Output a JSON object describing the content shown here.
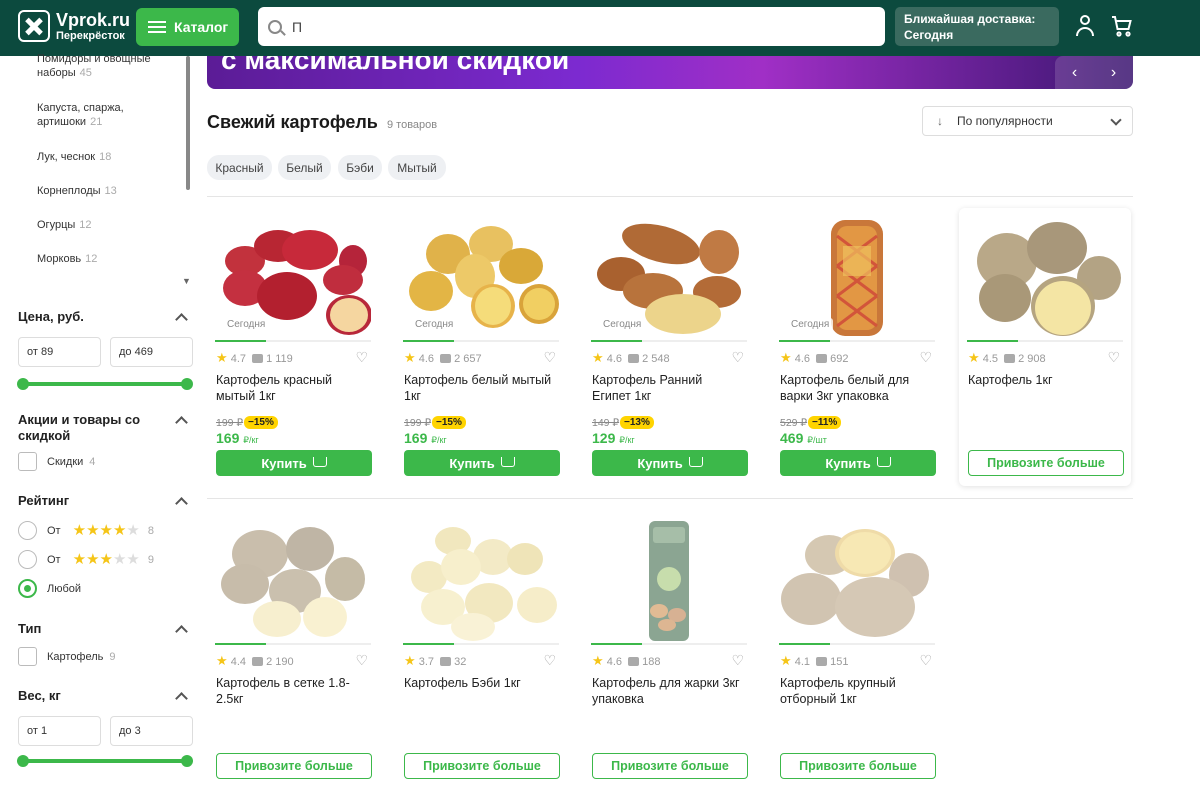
{
  "header": {
    "logo_name": "Vprok.ru",
    "logo_sub": "Перекрёсток",
    "catalog_label": "Каталог",
    "search_value": "П",
    "delivery_line1": "Ближайшая доставка:",
    "delivery_line2": "Сегодня"
  },
  "banner": {
    "text": "с максимальной скидкой"
  },
  "sidebar": {
    "categories": [
      {
        "label": "Помидоры и овощные наборы",
        "count": "45"
      },
      {
        "label": "Капуста, спаржа, артишоки",
        "count": "21"
      },
      {
        "label": "Лук, чеснок",
        "count": "18"
      },
      {
        "label": "Корнеплоды",
        "count": "13"
      },
      {
        "label": "Огурцы",
        "count": "12"
      },
      {
        "label": "Морковь",
        "count": "12"
      }
    ],
    "price": {
      "title": "Цена, руб.",
      "from": "от 89",
      "to": "до 469"
    },
    "promo": {
      "title": "Акции и товары со скидкой",
      "option": "Скидки",
      "count": "4"
    },
    "rating": {
      "title": "Рейтинг",
      "opt_prefix": "От",
      "opt1_count": "8",
      "opt2_count": "9",
      "any": "Любой"
    },
    "type": {
      "title": "Тип",
      "option": "Картофель",
      "count": "9"
    },
    "weight": {
      "title": "Вес, кг",
      "from": "от 1",
      "to": "до 3"
    }
  },
  "main": {
    "title": "Свежий картофель",
    "count": "9 товаров",
    "sort_label": "По популярности",
    "chips": [
      "Красный",
      "Белый",
      "Бэби",
      "Мытый"
    ],
    "today_label": "Сегодня",
    "buy_label": "Купить",
    "more_label": "Привозите больше"
  },
  "products": [
    {
      "name": "Картофель красный мытый 1кг",
      "rating": "4.7",
      "reviews": "1 119",
      "old_price": "199 ₽",
      "discount": "−15%",
      "price": "169",
      "unit": "₽/кг",
      "in_stock": true
    },
    {
      "name": "Картофель белый мытый 1кг",
      "rating": "4.6",
      "reviews": "2 657",
      "old_price": "199 ₽",
      "discount": "−15%",
      "price": "169",
      "unit": "₽/кг",
      "in_stock": true
    },
    {
      "name": "Картофель Ранний Египет 1кг",
      "rating": "4.6",
      "reviews": "2 548",
      "old_price": "149 ₽",
      "discount": "−13%",
      "price": "129",
      "unit": "₽/кг",
      "in_stock": true
    },
    {
      "name": "Картофель белый для варки 3кг упаковка",
      "rating": "4.6",
      "reviews": "692",
      "old_price": "529 ₽",
      "discount": "−11%",
      "price": "469",
      "unit": "₽/шт",
      "in_stock": true
    },
    {
      "name": "Картофель 1кг",
      "rating": "4.5",
      "reviews": "2 908",
      "in_stock": false
    },
    {
      "name": "Картофель в сетке 1.8-2.5кг",
      "rating": "4.4",
      "reviews": "2 190",
      "in_stock": false
    },
    {
      "name": "Картофель Бэби 1кг",
      "rating": "3.7",
      "reviews": "32",
      "in_stock": false
    },
    {
      "name": "Картофель для жарки 3кг упаковка",
      "rating": "4.6",
      "reviews": "188",
      "in_stock": false
    },
    {
      "name": "Картофель крупный отборный 1кг",
      "rating": "4.1",
      "reviews": "151",
      "in_stock": false
    }
  ],
  "colors": {
    "header_bg": "#0c4a3e",
    "accent": "#3cb84a",
    "discount": "#ffd400"
  }
}
